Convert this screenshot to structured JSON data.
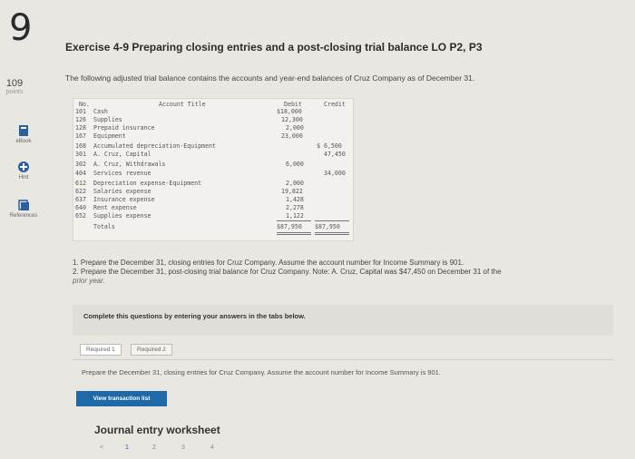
{
  "question": {
    "number": "9",
    "points": "109",
    "points_label": "points"
  },
  "sidebar": [
    {
      "label": "eBook",
      "icon": "book-icon"
    },
    {
      "label": "Hint",
      "icon": "hint-icon"
    },
    {
      "label": "References",
      "icon": "references-icon"
    }
  ],
  "title": "Exercise 4-9 Preparing closing entries and a post-closing trial balance LO P2, P3",
  "intro": "The following adjusted trial balance contains the accounts and year-end balances of Cruz Company as of December 31.",
  "trial_balance": {
    "headers": {
      "no": "No.",
      "title": "Account Title",
      "debit": "Debit",
      "credit": "Credit"
    },
    "rows": [
      {
        "no": "101",
        "title": "Cash",
        "debit": "$18,000",
        "credit": ""
      },
      {
        "no": "126",
        "title": "Supplies",
        "debit": "12,300",
        "credit": ""
      },
      {
        "no": "128",
        "title": "Prepaid insurance",
        "debit": "2,000",
        "credit": ""
      },
      {
        "no": "167",
        "title": "Equipment",
        "debit": "23,000",
        "credit": ""
      },
      {
        "no": "168",
        "title": "Accumulated depreciation-Equipment",
        "debit": "",
        "credit": "$ 6,500"
      },
      {
        "no": "301",
        "title": "A. Cruz, Capital",
        "debit": "",
        "credit": "47,450"
      },
      {
        "no": "302",
        "title": "A. Cruz, Withdrawals",
        "debit": "6,000",
        "credit": ""
      },
      {
        "no": "404",
        "title": "Services revenue",
        "debit": "",
        "credit": "34,000"
      },
      {
        "no": "612",
        "title": "Depreciation expense-Equipment",
        "debit": "2,000",
        "credit": ""
      },
      {
        "no": "622",
        "title": "Salaries expense",
        "debit": "19,822",
        "credit": ""
      },
      {
        "no": "637",
        "title": "Insurance expense",
        "debit": "1,428",
        "credit": ""
      },
      {
        "no": "640",
        "title": "Rent expense",
        "debit": "2,278",
        "credit": ""
      },
      {
        "no": "652",
        "title": "Supplies expense",
        "debit": "1,122",
        "credit": ""
      }
    ],
    "totals": {
      "label": "Totals",
      "debit": "$87,950",
      "credit": "$87,950"
    }
  },
  "instructions": {
    "item1": "1. Prepare the December 31, closing entries for Cruz Company. Assume the account number for Income Summary is 901.",
    "item2": "2. Prepare the December 31, post-closing trial balance for Cruz Company. Note: A. Cruz, Capital was $47,450 on December 31 of the",
    "item2b": "prior year."
  },
  "complete_box": "Complete this questions by entering your answers in the tabs below.",
  "tabs": [
    "Required 1",
    "Required 2"
  ],
  "tab_instruction": "Prepare the December 31, closing entries for Cruz Company. Assume the account number for Income Summary is 901.",
  "view_button": "View transaction list",
  "worksheet_title": "Journal entry worksheet",
  "pager": {
    "prev": "<",
    "pages": [
      "1",
      "2",
      "3",
      "4"
    ]
  }
}
